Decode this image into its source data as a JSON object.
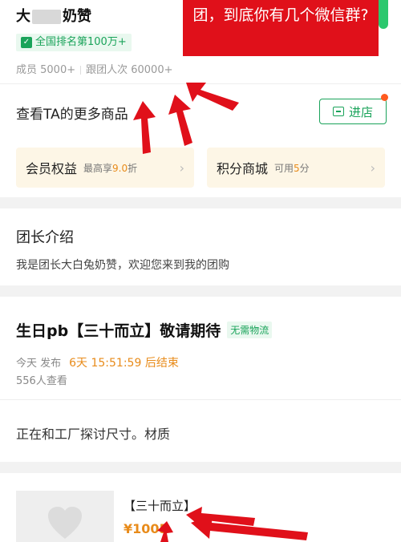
{
  "leader": {
    "name_prefix": "大",
    "name_suffix": "奶赞",
    "rank_badge": "全国排名第100万+",
    "members": "成员 5000+",
    "followers": "跟团人次 60000+"
  },
  "overlay": {
    "caption": "团，到底你有几个微信群?"
  },
  "goods": {
    "more_label": "查看TA的更多商品",
    "store_button": "进店"
  },
  "tiles": [
    {
      "title": "会员权益",
      "sub_prefix": "最高享",
      "sub_highlight": "9.0",
      "sub_suffix": "折"
    },
    {
      "title": "积分商城",
      "sub_prefix": "可用",
      "sub_highlight": "5",
      "sub_suffix": "分"
    }
  ],
  "intro": {
    "title": "团长介绍",
    "text": "我是团长大白兔奶赞，欢迎您来到我的团购"
  },
  "post": {
    "title": "生日pb【三十而立】敬请期待",
    "tag": "无需物流",
    "time_label": "今天 发布",
    "countdown": "6天 15:51:59 后结束",
    "views": "556人查看",
    "body": "正在和工厂探讨尺寸。材质"
  },
  "product": {
    "title": "【三十而立】",
    "price": "¥1005"
  },
  "colors": {
    "green": "#1aa35a",
    "red": "#e0101a",
    "orange": "#e88b1a",
    "tile_bg": "#fdf6e6"
  }
}
